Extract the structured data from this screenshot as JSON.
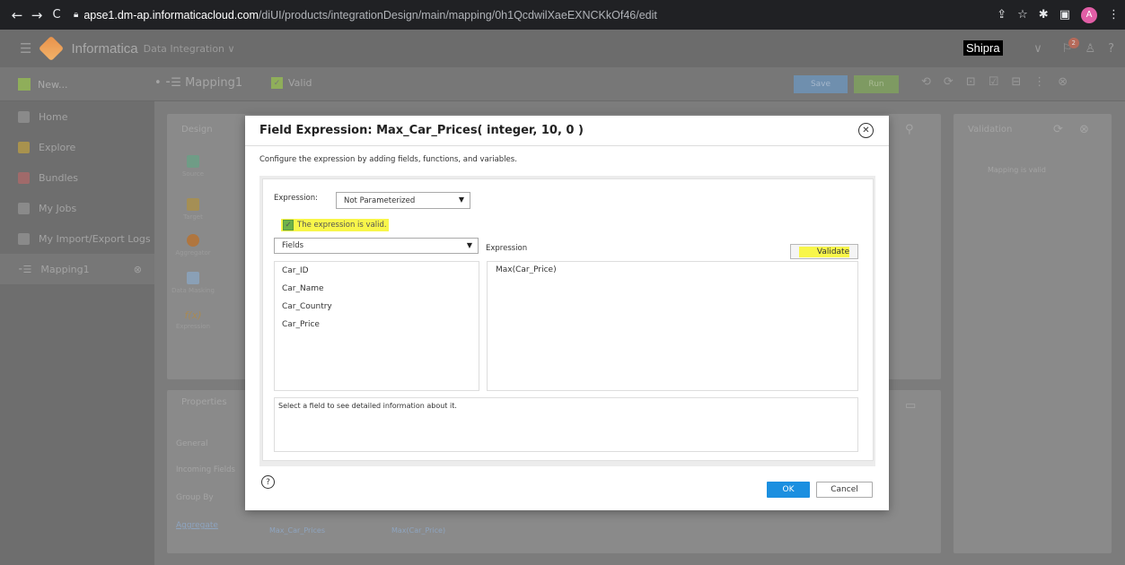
{
  "browser": {
    "url_host": "apse1.dm-ap.informaticacloud.com",
    "url_path": "/diUI/products/integrationDesign/main/mapping/0h1QcdwilXaeEXNCKkOf46/edit",
    "profile_initial": "A"
  },
  "app": {
    "brand": "Informatica",
    "product": "Data Integration ∨",
    "user": "Shipra",
    "notification_count": "2"
  },
  "toolbar": {
    "new_label": "New...",
    "mapping_name": "Mapping1",
    "status": "Valid",
    "save_label": "Save",
    "run_label": "Run"
  },
  "sidebar": {
    "items": [
      {
        "label": "Home"
      },
      {
        "label": "Explore"
      },
      {
        "label": "Bundles"
      },
      {
        "label": "My Jobs"
      },
      {
        "label": "My Import/Export Logs"
      },
      {
        "label": "Mapping1"
      }
    ]
  },
  "canvas": {
    "design_title": "Design",
    "palette": [
      "Source",
      "Target",
      "Aggregator",
      "Data Masking",
      "Expression"
    ],
    "validation_title": "Validation",
    "validation_msg": "Mapping is valid",
    "properties_title": "Properties",
    "props_items": [
      "General",
      "Incoming Fields",
      "Group By",
      "Aggregate"
    ],
    "agg_field": "Max_Car_Prices",
    "agg_expr": "Max(Car_Price)"
  },
  "modal": {
    "title": "Field Expression: Max_Car_Prices( integer, 10, 0 )",
    "description": "Configure the expression by adding fields, functions, and variables.",
    "expression_label": "Expression:",
    "parameter_option": "Not Parameterized",
    "valid_message": "The expression is valid.",
    "fields_dropdown": "Fields",
    "expression_heading": "Expression",
    "validate_label": "Validate",
    "fields": [
      "Car_ID",
      "Car_Name",
      "Car_Country",
      "Car_Price"
    ],
    "expression_value": "Max(Car_Price)",
    "info_text": "Select a field to see detailed information about it.",
    "ok_label": "OK",
    "cancel_label": "Cancel"
  }
}
